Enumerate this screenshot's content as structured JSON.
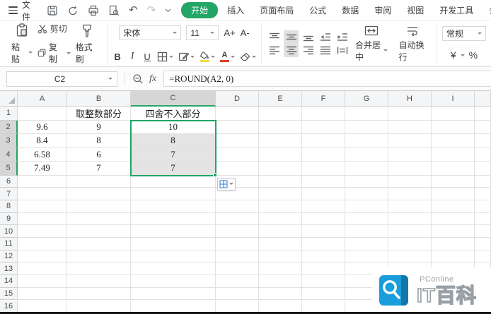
{
  "colors": {
    "accent_green": "#23a566",
    "header_highlight": "#d6d6d6",
    "selection_fill": "#e4e4e4",
    "fill_yellow": "#f2dd3e",
    "font_color_red": "#e03e2d",
    "watermark_blue": "#199ddb",
    "watermark_blue_dark": "#1377ab"
  },
  "menubar": {
    "file_label": "文件",
    "quick_tool_icons": [
      "save-icon",
      "export-icon",
      "print-icon",
      "print-preview-icon",
      "undo-icon",
      "redo-icon",
      "more-icon"
    ],
    "undo_glyph": "↶",
    "redo_glyph": "↷",
    "tabs": [
      {
        "label": "开始",
        "active": true
      },
      {
        "label": "插入",
        "active": false
      },
      {
        "label": "页面布局",
        "active": false
      },
      {
        "label": "公式",
        "active": false
      },
      {
        "label": "数据",
        "active": false
      },
      {
        "label": "审阅",
        "active": false
      },
      {
        "label": "视图",
        "active": false
      },
      {
        "label": "开发工具",
        "active": false
      },
      {
        "label": "会",
        "active": false
      }
    ]
  },
  "ribbon": {
    "clipboard": {
      "paste": "粘贴",
      "cut": "剪切",
      "copy": "复制",
      "format_painter": "格式刷"
    },
    "font": {
      "family": "宋体",
      "size": "11",
      "grow": "A+",
      "shrink": "A-",
      "bold": "B",
      "italic": "I",
      "underline": "U"
    },
    "alignment": {
      "merge_center": "合并居中",
      "wrap_text": "自动换行"
    },
    "number": {
      "format": "常规",
      "currency": "¥",
      "percent": "%"
    }
  },
  "formula_bar": {
    "name_box": "C2",
    "fx_label": "fx",
    "formula": "=ROUND(A2, 0)"
  },
  "grid": {
    "columns": [
      "A",
      "B",
      "C",
      "D",
      "E",
      "F",
      "G",
      "H",
      "I"
    ],
    "rows": [
      1,
      2,
      3,
      4,
      5,
      6,
      7,
      8,
      9,
      10,
      11,
      12,
      13,
      14,
      15,
      16
    ],
    "cells": {
      "B1": "取整数部分",
      "C1": "四舍不入部分",
      "A2": "9.6",
      "B2": "9",
      "C2": "10",
      "A3": "8.4",
      "B3": "8",
      "C3": "8",
      "A4": "6.58",
      "B4": "6",
      "C4": "7",
      "A5": "7.49",
      "B5": "7",
      "C5": "7"
    },
    "selection": {
      "range": "C2:C5",
      "active_cell": "C2",
      "highlight_col": "C",
      "highlight_rows": [
        2,
        3,
        4,
        5
      ]
    }
  },
  "watermark": {
    "brand": "PConline",
    "title": "IT百科"
  }
}
